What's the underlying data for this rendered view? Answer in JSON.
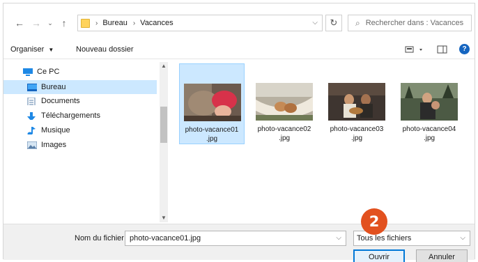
{
  "address": {
    "crumbs": [
      "Bureau",
      "Vacances"
    ],
    "search_placeholder": "Rechercher dans : Vacances"
  },
  "toolbar": {
    "organize_label": "Organiser",
    "new_folder_label": "Nouveau dossier"
  },
  "sidebar": {
    "items": [
      {
        "label": "Ce PC",
        "icon": "computer-icon"
      },
      {
        "label": "Bureau",
        "icon": "desktop-icon"
      },
      {
        "label": "Documents",
        "icon": "document-icon"
      },
      {
        "label": "Téléchargements",
        "icon": "download-icon"
      },
      {
        "label": "Musique",
        "icon": "music-icon"
      },
      {
        "label": "Images",
        "icon": "image-icon"
      }
    ],
    "selected_index": 1
  },
  "files": [
    {
      "name_line1": "photo-vacance01",
      "name_line2": ".jpg",
      "selected": true
    },
    {
      "name_line1": "photo-vacance02",
      "name_line2": ".jpg",
      "selected": false
    },
    {
      "name_line1": "photo-vacance03",
      "name_line2": ".jpg",
      "selected": false
    },
    {
      "name_line1": "photo-vacance04",
      "name_line2": ".jpg",
      "selected": false
    }
  ],
  "bottom": {
    "filename_label": "Nom du fichier :",
    "filename_value": "photo-vacance01.jpg",
    "filetype_value": "Tous les fichiers",
    "open_label": "Ouvrir",
    "cancel_label": "Annuler"
  },
  "badge": {
    "number": "2",
    "color": "#e2511f"
  },
  "colors": {
    "selection": "#cce8ff",
    "accent": "#0078d7"
  }
}
